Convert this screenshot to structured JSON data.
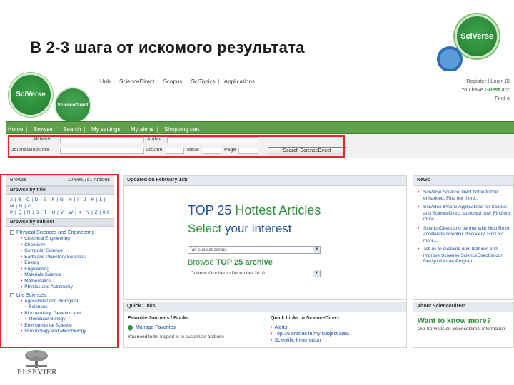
{
  "slide": {
    "title": "В 2-3 шага от искомого результата",
    "top_logo_text": "SciVerse"
  },
  "header": {
    "logo_main": "SciVerse",
    "logo_sub": "ScienceDirect",
    "nav": [
      "Hub",
      "ScienceDirect",
      "Scopus",
      "SciTopics",
      "Applications"
    ],
    "register": "Register",
    "login": "Login",
    "welcome_prefix": "You have",
    "guest": "Guest",
    "welcome_suffix": "acc",
    "find_out": "Find o"
  },
  "greenbar": {
    "items": [
      "Home",
      "Browse",
      "Search",
      "My settings",
      "My alerts",
      "Shopping cart"
    ]
  },
  "search": {
    "all_fields": "All fields",
    "author": "Author",
    "journal": "Journal/Book title",
    "volume": "Volume",
    "issue": "Issue",
    "page": "Page",
    "button": "Search ScienceDirect"
  },
  "browse": {
    "label": "Browse",
    "count": "10,696,751 Articles",
    "by_title": "Browse by title",
    "letters_row1": "A | B | C | D | E | F | G | H | I | J | K | L | M | N | O",
    "letters_row2": "P | Q | R | S | T | U | V | W | X | Y | Z | 0-9",
    "by_subject": "Browse by subject",
    "cat1": "Physical Sciences and Engineering",
    "cat1_items": [
      "Chemical Engineering",
      "Chemistry",
      "Computer Science",
      "Earth and Planetary Sciences",
      "Energy",
      "Engineering",
      "Materials Science",
      "Mathematics",
      "Physics and Astronomy"
    ],
    "cat2": "Life Sciences",
    "cat2_items": [
      "Agricultural and Biological",
      "Sciences",
      "Biochemistry, Genetics and",
      "Molecular Biology",
      "Environmental Science",
      "Immunology and Microbiology"
    ]
  },
  "center": {
    "updated": "Updated on February 1st!",
    "top25_a": "TOP 25 ",
    "top25_b": "Hottest Articles",
    "select_a": "Select ",
    "select_b": "your interest",
    "dropdown1": "[all subject areas]",
    "browse_a": "Browse ",
    "browse_b": "TOP 25 archive",
    "dropdown2": "Current: October to December 2010"
  },
  "quick": {
    "title": "Quick Links",
    "fav_title": "Favorite Journals / Books",
    "manage": "Manage Favorites",
    "login_note": "You need to be logged in to customize and use",
    "ql_title": "Quick Links in ScienceDirect",
    "links": [
      "Alerts",
      "Top-25 articles in my subject area",
      "Scientific Information"
    ]
  },
  "news": {
    "title": "News",
    "items": [
      "SciVerse ScienceDirect home further enhanced. Find out more...",
      "SciVerse iPhone Applications for Scopus and ScienceDirect launched now. Find out more...",
      "ScienceDirect and partner with NextBio to accelerate scientific discovery. Find out more...",
      "Tell us to evaluate new features and improve SciVerse ScienceDirect in our Design Partner Program"
    ]
  },
  "about": {
    "title": "About ScienceDirect",
    "want": "Want to know more?",
    "text": "Our Services on ScienceDirect information"
  },
  "footer": {
    "brand": "ELSEVIER"
  }
}
